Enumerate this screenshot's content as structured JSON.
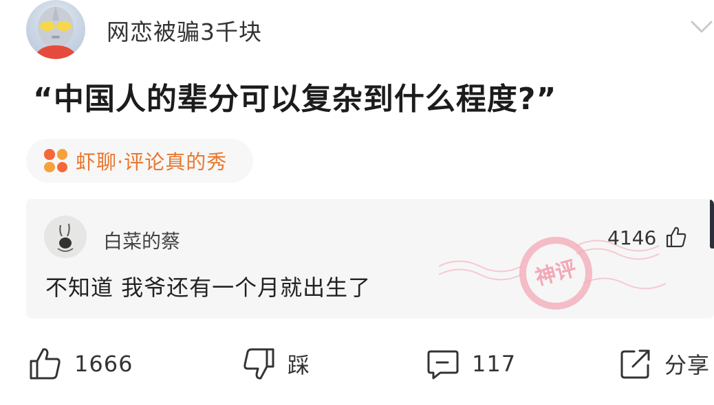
{
  "post": {
    "author": "网恋被骗3千块",
    "title": "“中国人的辈分可以复杂到什么程度?”"
  },
  "topic": {
    "label": "虾聊·评论真的秀",
    "dot_colors": [
      "#f5683a",
      "#f6a23a",
      "#f6a23a",
      "#f5683a"
    ]
  },
  "comment": {
    "author": "白菜的蔡",
    "likes": "4146",
    "text": "不知道 我爷还有一个月就出生了",
    "stamp_text": "神评",
    "stamp_color": "#f3a8b6"
  },
  "actions": {
    "like_count": "1666",
    "dislike_label": "踩",
    "comment_count": "117",
    "share_label": "分享"
  }
}
